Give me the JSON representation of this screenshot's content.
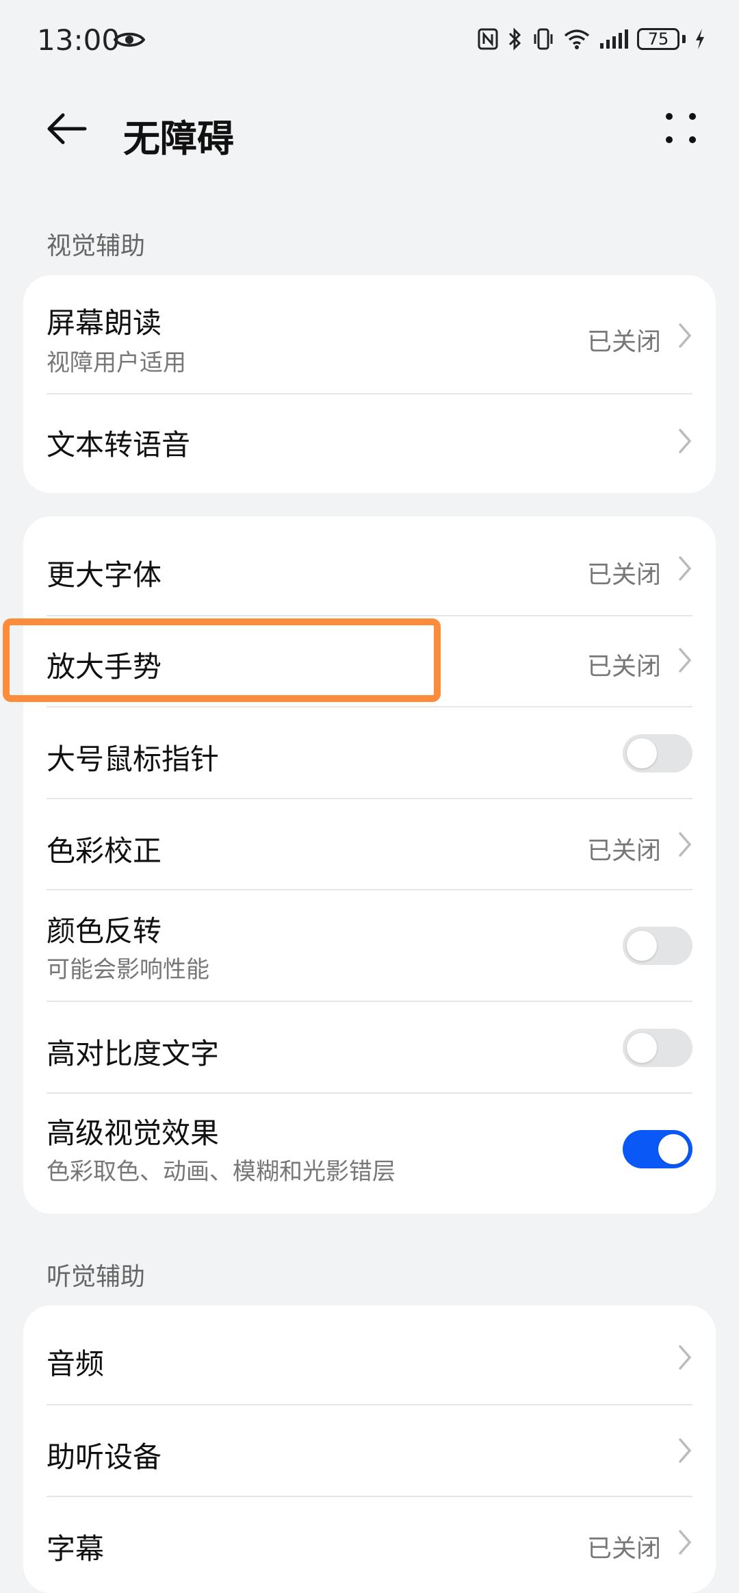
{
  "status_bar": {
    "time": "13:00",
    "battery_level": "75",
    "icons": [
      "eye-icon",
      "nfc-icon",
      "bluetooth-icon",
      "vibrate-icon",
      "wifi-icon",
      "signal-icon",
      "battery-icon",
      "charging-icon"
    ]
  },
  "header": {
    "title": "无障碍",
    "back_icon": "back-arrow-icon",
    "more_icon": "more-dots-icon"
  },
  "sections": {
    "visual": {
      "title": "视觉辅助",
      "items": [
        {
          "label": "屏幕朗读",
          "sub": "视障用户适用",
          "value": "已关闭"
        },
        {
          "label": "文本转语音"
        }
      ]
    },
    "display": {
      "items": [
        {
          "label": "更大字体",
          "value": "已关闭"
        },
        {
          "label": "放大手势",
          "value": "已关闭",
          "highlighted": true
        },
        {
          "label": "大号鼠标指针",
          "toggle": false
        },
        {
          "label": "色彩校正",
          "value": "已关闭"
        },
        {
          "label": "颜色反转",
          "sub": "可能会影响性能",
          "toggle": false
        },
        {
          "label": "高对比度文字",
          "toggle": false
        },
        {
          "label": "高级视觉效果",
          "sub": "色彩取色、动画、模糊和光影错层",
          "toggle": true
        }
      ]
    },
    "hearing": {
      "title": "听觉辅助",
      "items": [
        {
          "label": "音频"
        },
        {
          "label": "助听设备"
        },
        {
          "label": "字幕",
          "value": "已关闭"
        }
      ]
    }
  },
  "colors": {
    "background": "#f1f3f5",
    "card": "#ffffff",
    "toggle_on": "#0a59f7",
    "highlight": "#fa8c3c"
  }
}
